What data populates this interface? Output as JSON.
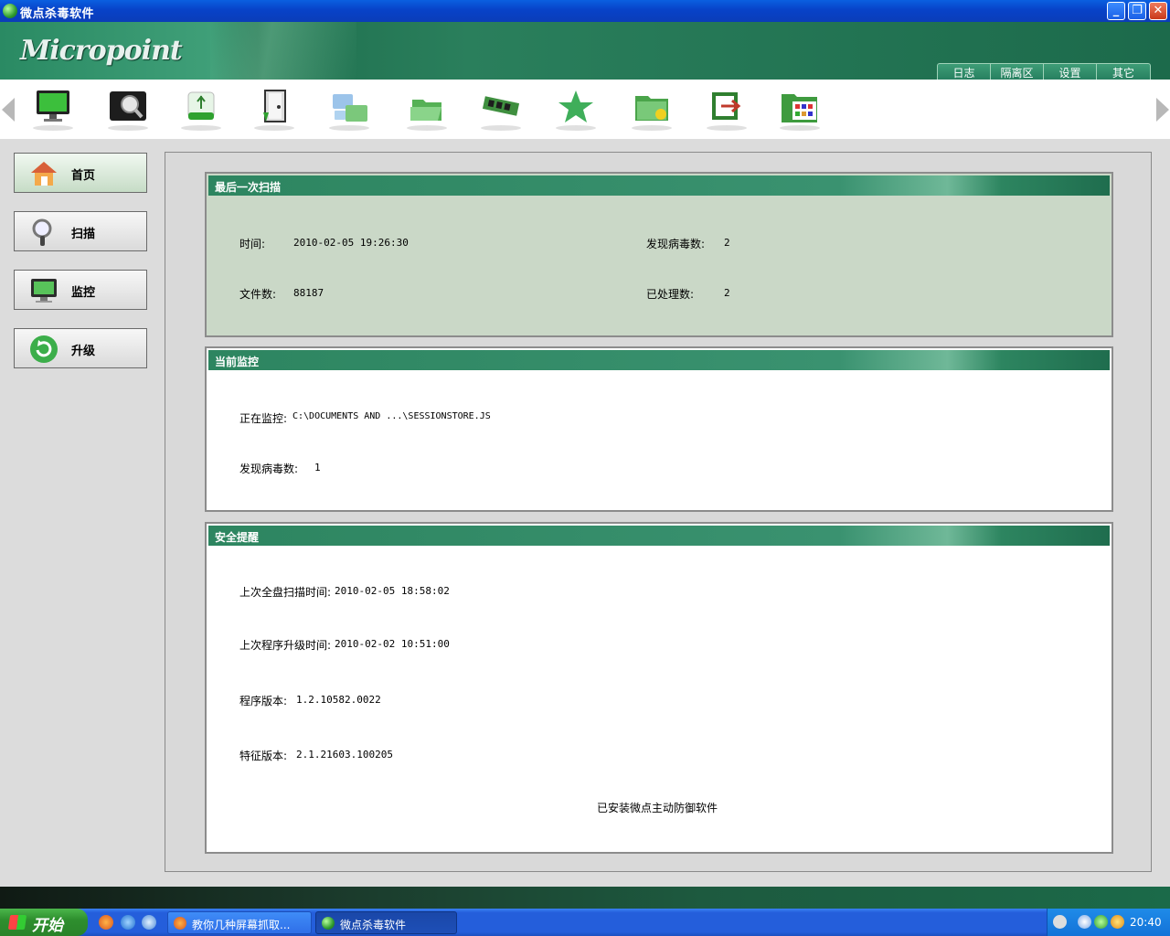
{
  "window": {
    "title": "微点杀毒软件",
    "min_glyph": "_",
    "max_glyph": "❐",
    "close_glyph": "✕"
  },
  "header": {
    "logo_text": "Micropoint",
    "menu": [
      {
        "label": "日志"
      },
      {
        "label": "隔离区"
      },
      {
        "label": "设置"
      },
      {
        "label": "其它"
      }
    ]
  },
  "toolbar": {
    "icons": [
      "monitor-icon",
      "disk-scan-icon",
      "usb-drive-icon",
      "door-exit-icon",
      "network-folder-icon",
      "open-folder-icon",
      "memory-icon",
      "star-icon",
      "folder-settings-icon",
      "export-icon",
      "folder-grid-icon"
    ]
  },
  "nav": [
    {
      "label": "首页",
      "icon": "home-icon",
      "active": true
    },
    {
      "label": "扫描",
      "icon": "magnifier-icon"
    },
    {
      "label": "监控",
      "icon": "monitor-icon"
    },
    {
      "label": "升级",
      "icon": "refresh-icon"
    }
  ],
  "last_scan": {
    "title": "最后一次扫描",
    "time_label": "时间:",
    "time_value": "2010-02-05 19:26:30",
    "files_label": "文件数:",
    "files_value": "88187",
    "virus_label": "发现病毒数:",
    "virus_value": "2",
    "handled_label": "已处理数:",
    "handled_value": "2"
  },
  "monitor": {
    "title": "当前监控",
    "path_label": "正在监控:",
    "path_value": "C:\\DOCUMENTS AND ...\\SESSIONSTORE.JS",
    "virus_label": "发现病毒数:",
    "virus_value": "1"
  },
  "security": {
    "title": "安全提醒",
    "full_scan_label": "上次全盘扫描时间:",
    "full_scan_value": "2010-02-05 18:58:02",
    "upgrade_label": "上次程序升级时间:",
    "upgrade_value": "2010-02-02 10:51:00",
    "program_version_label": "程序版本:",
    "program_version_value": "1.2.10582.0022",
    "signature_version_label": "特征版本:",
    "signature_version_value": "2.1.21603.100205",
    "installed_note": "已安装微点主动防御软件"
  },
  "taskbar": {
    "start_label": "开始",
    "tasks": [
      {
        "label": "教你几种屏幕抓取..."
      },
      {
        "label": "微点杀毒软件"
      }
    ],
    "clock": "20:40"
  },
  "colors": {
    "brand_green": "#2d8560",
    "xp_blue": "#245edb",
    "panel_bg_green": "#cad8c7"
  }
}
